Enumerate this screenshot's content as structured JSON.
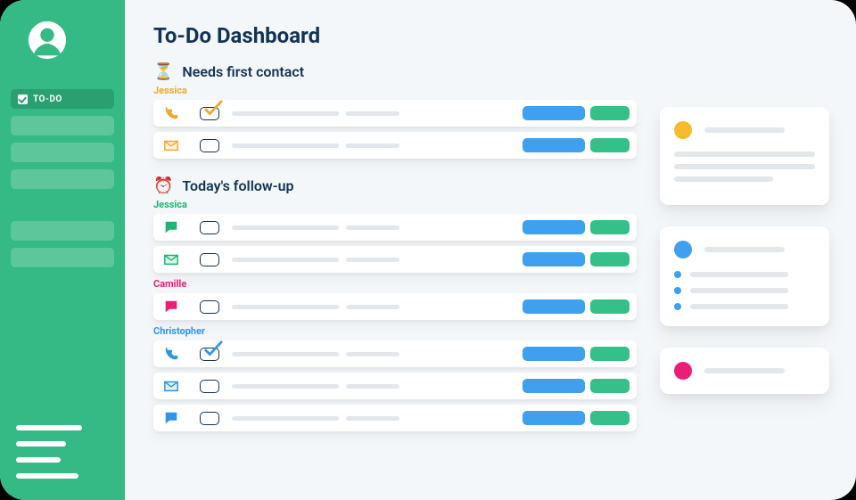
{
  "sidebar": {
    "nav": [
      {
        "label": "TO-DO",
        "active": true
      }
    ]
  },
  "page": {
    "title": "To-Do Dashboard"
  },
  "sections": [
    {
      "emoji": "⏳",
      "title": "Needs first contact",
      "groups": [
        {
          "owner": "Jessica",
          "owner_color": "orange",
          "tasks": [
            {
              "icon": "phone",
              "icon_color": "orange",
              "checked": true,
              "check_color": "orange"
            },
            {
              "icon": "mail",
              "icon_color": "orange",
              "checked": false
            }
          ]
        }
      ]
    },
    {
      "emoji": "⏰",
      "title": "Today's follow-up",
      "groups": [
        {
          "owner": "Jessica",
          "owner_color": "green",
          "tasks": [
            {
              "icon": "chat",
              "icon_color": "green",
              "checked": false
            },
            {
              "icon": "mail",
              "icon_color": "green",
              "checked": false
            }
          ]
        },
        {
          "owner": "Camille",
          "owner_color": "pink",
          "tasks": [
            {
              "icon": "chat",
              "icon_color": "pink",
              "checked": false
            }
          ]
        },
        {
          "owner": "Christopher",
          "owner_color": "blue",
          "tasks": [
            {
              "icon": "phone",
              "icon_color": "blue",
              "checked": true,
              "check_color": "blue"
            },
            {
              "icon": "mail",
              "icon_color": "blue",
              "checked": false
            },
            {
              "icon": "chat",
              "icon_color": "blue",
              "checked": false
            }
          ]
        }
      ]
    }
  ],
  "cards": [
    {
      "dot": "yellow",
      "style": "paragraph"
    },
    {
      "dot": "blue",
      "style": "bullets"
    },
    {
      "dot": "pink",
      "style": "slim"
    }
  ],
  "colors": {
    "brand_green": "#35b985",
    "accent_blue": "#3ea0ee",
    "accent_green": "#34c088",
    "orange": "#f2a72d",
    "pink": "#ea1e77",
    "blue": "#2e96e8",
    "navy": "#123354"
  }
}
